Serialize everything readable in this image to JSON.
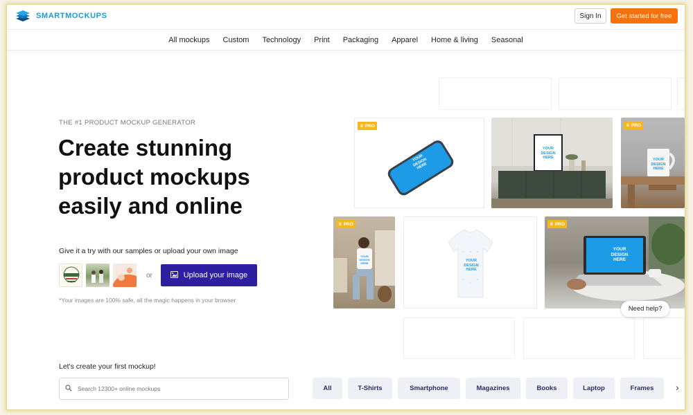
{
  "header": {
    "logo_text": "SMARTMOCKUPS",
    "signin_label": "Sign In",
    "cta_label": "Get started for free",
    "accent": "#f5720f",
    "brand": "#1a9ad6"
  },
  "nav": {
    "items": [
      {
        "label": "All mockups"
      },
      {
        "label": "Custom"
      },
      {
        "label": "Technology"
      },
      {
        "label": "Print"
      },
      {
        "label": "Packaging"
      },
      {
        "label": "Apparel"
      },
      {
        "label": "Home & living"
      },
      {
        "label": "Seasonal"
      }
    ]
  },
  "hero": {
    "eyebrow": "THE #1 PRODUCT MOCKUP GENERATOR",
    "headline": "Create stunning product mockups easily and online",
    "try_text": "Give it a try with our samples or upload your own image",
    "or_text": "or",
    "upload_label": "Upload your image",
    "upload_color": "#2d1fa0",
    "safe_note": "*Your images are 100% safe, all the magic happens in your browser"
  },
  "gallery": {
    "pro_badge": "PRO",
    "design_text": "YOUR DESIGN HERE"
  },
  "help": {
    "label": "Need help?"
  },
  "catalog": {
    "heading": "Let's create your first mockup!",
    "search_placeholder": "Search 12300+ online mockups",
    "filters": [
      {
        "label": "All"
      },
      {
        "label": "T-Shirts"
      },
      {
        "label": "Smartphone"
      },
      {
        "label": "Magazines"
      },
      {
        "label": "Books"
      },
      {
        "label": "Laptop"
      },
      {
        "label": "Frames"
      }
    ],
    "next_icon": "chevron-right-icon"
  }
}
